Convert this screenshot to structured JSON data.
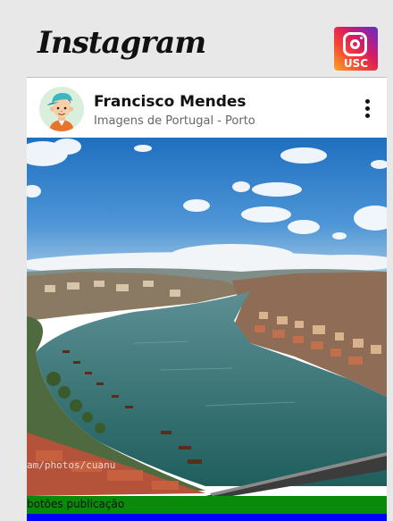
{
  "header": {
    "logo_text": "Instagram",
    "app_icon": {
      "name": "instagram-camera-icon",
      "badge_text": "USC"
    }
  },
  "post": {
    "user_name": "Francisco Mendes",
    "location": "Imagens de Portugal - Porto",
    "avatar_icon": "cartoon-avatar",
    "more_icon": "vertical-ellipsis-icon",
    "image": {
      "description_subject": "Porto Douro river panorama",
      "watermark": "am/photos/cuanu"
    },
    "actions_label": "botões publicação"
  },
  "colors": {
    "actions_bar": "#0a8a0a",
    "blue_bar": "#0000ff",
    "card_background": "#ffffff",
    "page_background": "#e8e8e8"
  }
}
